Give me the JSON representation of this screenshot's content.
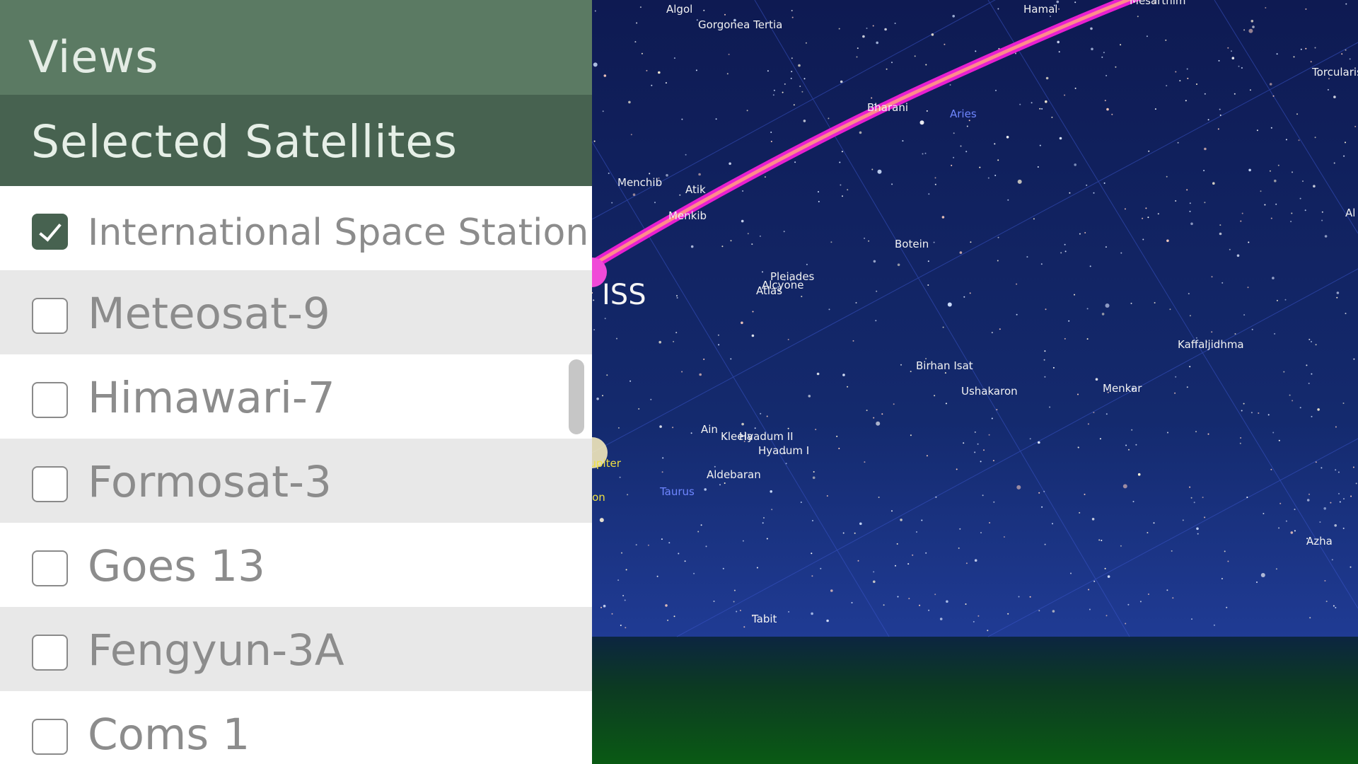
{
  "panel": {
    "views_title": "Views",
    "selected_title": "Selected Satellites",
    "satellites": [
      {
        "label": "International Space Station",
        "checked": true
      },
      {
        "label": "Meteosat-9",
        "checked": false
      },
      {
        "label": "Himawari-7",
        "checked": false
      },
      {
        "label": "Formosat-3",
        "checked": false
      },
      {
        "label": "Goes 13",
        "checked": false
      },
      {
        "label": "Fengyun-3A",
        "checked": false
      },
      {
        "label": "Coms 1",
        "checked": false
      }
    ]
  },
  "sky": {
    "iss_label": "ISS",
    "stars": {
      "algol": "Algol",
      "gorgonea": "Gorgonea Tertia",
      "hamal": "Hamal",
      "mesarthim": "Mesarthim",
      "torcularis": "Torcularis",
      "bharani": "Bharani",
      "menchib": "Menchib",
      "atik": "Atik",
      "menkib": "Menkib",
      "botein": "Botein",
      "pleiades": "Pleiades",
      "alcyone": "Alcyone",
      "atlas": "Atlas",
      "kaffaljidhma": "Kaffaljidhma",
      "birhan_isat": "Birhan Isat",
      "ushakaron": "Ushakaron",
      "menkar": "Menkar",
      "ain": "Ain",
      "hyadum_ii": "Hyadum II",
      "kleeia": "Kleeia",
      "hyadum_i": "Hyadum I",
      "aldebaran": "Aldebaran",
      "azha": "Azha",
      "tabit": "Tabit",
      "al_edge": "Al"
    },
    "constellations": {
      "aries": "Aries",
      "taurus": "Taurus"
    },
    "planets": {
      "jupiter": "Jupiter",
      "moon": "Moon"
    },
    "colors": {
      "orbit_outer": "#e81fd0",
      "orbit_inner": "#ff8c8c",
      "grid": "#3a55c8"
    }
  }
}
